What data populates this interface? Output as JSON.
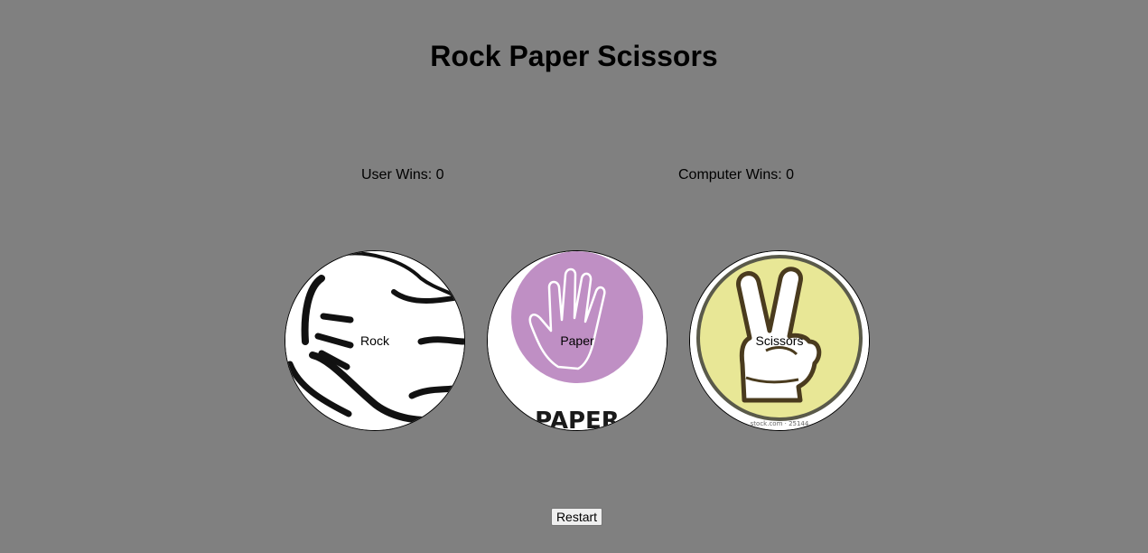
{
  "title": "Rock Paper Scissors",
  "scores": {
    "user_label": "User Wins: 0",
    "computer_label": "Computer Wins: 0"
  },
  "choices": [
    {
      "label": "Rock",
      "icon": "rock-fist-icon"
    },
    {
      "label": "Paper",
      "icon": "paper-hand-icon",
      "image_text": "PAPER",
      "accent": "#bf8fc4"
    },
    {
      "label": "Scissors",
      "icon": "scissors-peace-hand-icon",
      "image_text": "...stock.com · 25144...",
      "accent": "#e8e796"
    }
  ],
  "restart_label": "Restart",
  "colors": {
    "background": "#808080",
    "paper_circle": "#bf8fc4",
    "scissors_circle": "#e8e796"
  }
}
